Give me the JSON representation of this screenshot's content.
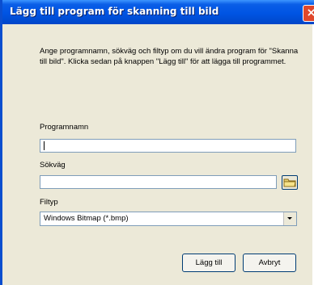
{
  "dialog": {
    "title": "Lägg till program för skanning till bild",
    "close_glyph": "×",
    "description": "Ange programnamn, sökväg och filtyp om du vill ändra program för \"Skanna till bild\". Klicka sedan på knappen \"Lägg till\" för att lägga till programmet.",
    "fields": {
      "program_name_label": "Programnamn",
      "program_name_value": "",
      "path_label": "Sökväg",
      "path_value": "",
      "filetype_label": "Filtyp",
      "filetype_value": "Windows Bitmap (*.bmp)"
    },
    "buttons": {
      "add": "Lägg till",
      "cancel": "Avbryt"
    },
    "icons": {
      "browse": "folder-icon",
      "dropdown": "chevron-down-icon",
      "close": "close-icon"
    },
    "colors": {
      "titlebar": "#0054e3",
      "window_bg": "#ece9d8",
      "close_button": "#e0482c"
    }
  }
}
